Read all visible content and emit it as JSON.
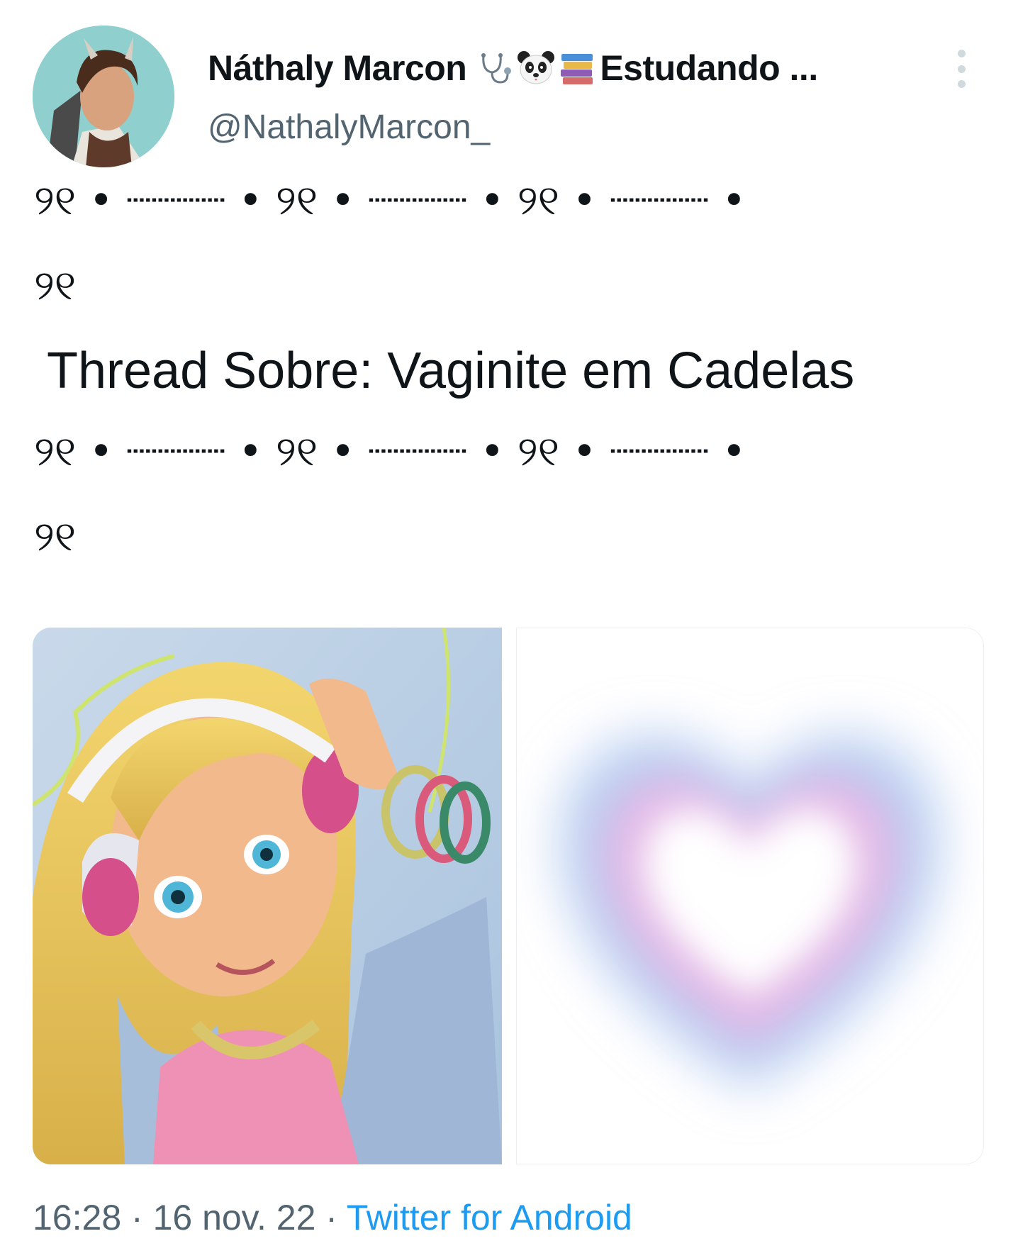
{
  "tweet": {
    "author": {
      "display_name": "Náthaly Marcon",
      "name_suffix": "Estudando ...",
      "name_icons": [
        "stethoscope-icon",
        "panda-icon",
        "books-icon"
      ],
      "handle": "@NathalyMarcon_"
    },
    "decoration_line": "୨୧ • ┈┈┈┈ • ୨୧ • ┈┈┈┈ • ୨୧ • ┈┈┈┈ •",
    "decoration_end": "୨୧",
    "title": "Thread  Sobre: Vaginite em Cadelas",
    "media": [
      {
        "kind": "illustration",
        "subject": "anime-girl-with-headphones-image"
      },
      {
        "kind": "illustration",
        "subject": "gradient-heart-image"
      }
    ],
    "meta": {
      "time": "16:28",
      "separator": " · ",
      "date": "16 nov. 22",
      "source": "Twitter for Android"
    }
  },
  "colors": {
    "text": "#0f1419",
    "secondary": "#536471",
    "link": "#1d9bf0"
  }
}
